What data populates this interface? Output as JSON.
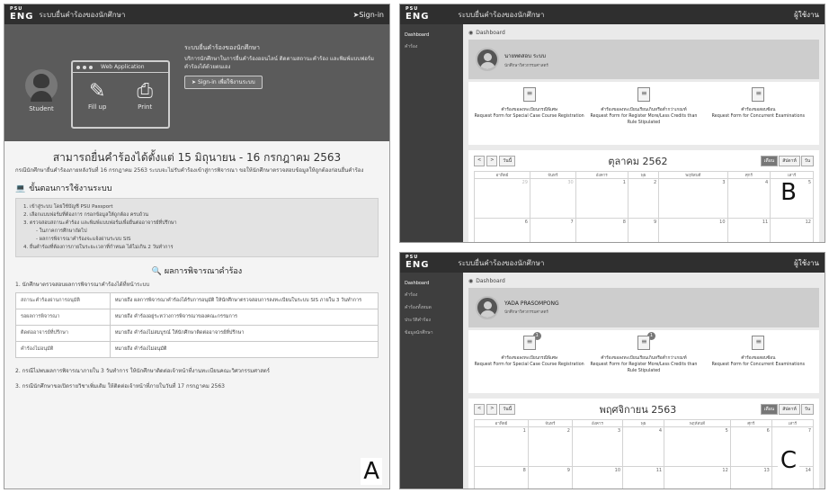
{
  "panelA": {
    "logo_top": "PSU",
    "logo_main": "ENG",
    "header_title": "ระบบยื่นคำร้องของนักศึกษา",
    "signin": "Sign-in",
    "hero": {
      "student_label": "Student",
      "web_app_label": "Web Application",
      "fillup_label": "Fill up",
      "print_label": "Print",
      "heading": "ระบบยื่นคำร้องของนักศึกษา",
      "desc": "บริการนักศึกษาในการยื่นคำร้องออนไลน์ ติดตามสถานะคำร้อง และพิมพ์แบบฟอร์มคำร้องได้ด้วยตนเอง",
      "button": "Sign-in เพื่อใช้งานระบบ"
    },
    "open_period": "สามารถยื่นคำร้องได้ตั้งแต่ 15 มิถุนายน - 16 กรกฎาคม 2563",
    "notice": "กรณีนักศึกษายื่นคำร้องภายหลังวันที่ 16 กรกฎาคม 2563 ระบบจะไม่รับคำร้องเข้าสู่การพิจารณา ขอให้นักศึกษาตรวจสอบข้อมูลให้ถูกต้องก่อนยื่นคำร้อง",
    "steps_title": "ขั้นตอนการใช้งานระบบ",
    "steps": [
      "1. เข้าสู่ระบบ โดยใช้บัญชี PSU Passport",
      "2. เลือกแบบฟอร์มที่ต้องการ กรอกข้อมูลให้ถูกต้อง ครบถ้วน",
      "3. ตรวจสอบสถานะคำร้อง และพิมพ์แบบฟอร์มเพื่อยื่นต่ออาจารย์ที่ปรึกษา",
      "- ในภาคการศึกษาถัดไป",
      "- ผลการพิจารณาคำร้องจะแจ้งผ่านระบบ SIS",
      "4. ยื่นคำร้องที่ต้องการภายในระยะเวลาที่กำหนด ได้ไม่เกิน 2 วันทำการ"
    ],
    "result_title": "ผลการพิจารณาคำร้อง",
    "result_intro": "1. นักศึกษาตรวจสอบผลการพิจารณาคำร้องได้ที่หน้าระบบ",
    "result_rows": [
      {
        "status": "สถานะคำร้องผ่านการอนุมัติ",
        "detail": "หมายถึง ผลการพิจารณาคำร้องได้รับการอนุมัติ ให้นักศึกษาตรวจสอบการลงทะเบียนในระบบ SIS ภายใน 3 วันทำการ"
      },
      {
        "status": "รอผลการพิจารณา",
        "detail": "หมายถึง คำร้องอยู่ระหว่างการพิจารณาของคณะกรรมการ"
      },
      {
        "status": "ติดต่ออาจารย์ที่ปรึกษา",
        "detail": "หมายถึง คำร้องไม่สมบูรณ์ ให้นักศึกษาติดต่ออาจารย์ที่ปรึกษา"
      },
      {
        "status": "คำร้องไม่อนุมัติ",
        "detail": "หมายถึง คำร้องไม่อนุมัติ"
      }
    ],
    "footer_2": "2. กรณีไม่พบผลการพิจารณาภายใน 3 วันทำการ ให้นักศึกษาติดต่อเจ้าหน้าที่งานทะเบียนคณะวิศวกรรมศาสตร์",
    "footer_3": "3. กรณีนักศึกษาขอเปิดรายวิชาเพิ่มเติม ให้ติดต่อเจ้าหน้าที่ภายในวันที่ 17 กรกฎาคม 2563",
    "letter": "A"
  },
  "panelB": {
    "logo_top": "PSU",
    "logo_main": "ENG",
    "header_title": "ระบบยื่นคำร้องของนักศึกษา",
    "user": "ผู้ใช้งาน",
    "menu": [
      "Dashboard",
      "คำร้อง"
    ],
    "crumb": "Dashboard",
    "profile_name": "นายทดสอบ ระบบ",
    "profile_sub": "นักศึกษาวิศวกรรมศาสตร์",
    "forms": [
      {
        "th": "คำร้องขอลงทะเบียนกรณีพิเศษ",
        "en": "Request Form for Special Case Course Registration"
      },
      {
        "th": "คำร้องขอลงทะเบียนเรียนเกินหรือต่ำกว่าเกณฑ์",
        "en": "Request Form for Register More/Less Credits than Rule Stipulated"
      },
      {
        "th": "คำร้องขอสอบซ้อน",
        "en": "Request Form for Concurrent Examinations"
      }
    ],
    "cal": {
      "prev": "<",
      "next": ">",
      "today": "วันนี้",
      "title": "ตุลาคม 2562",
      "views": [
        "เดือน",
        "สัปดาห์",
        "วัน"
      ],
      "days": [
        "อาทิตย์",
        "จันทร์",
        "อังคาร",
        "พุธ",
        "พฤหัสบดี",
        "ศุกร์",
        "เสาร์"
      ],
      "row1": [
        "29",
        "30",
        "1",
        "2",
        "3",
        "4",
        "5"
      ],
      "row2": [
        "6",
        "7",
        "8",
        "9",
        "10",
        "11",
        "12"
      ]
    },
    "letter": "B"
  },
  "panelC": {
    "logo_top": "PSU",
    "logo_main": "ENG",
    "header_title": "ระบบยื่นคำร้องของนักศึกษา",
    "user": "ผู้ใช้งาน",
    "menu": [
      "Dashboard",
      "คำร้อง",
      "คำร้องทั้งหมด",
      "ประวัติคำร้อง",
      "ข้อมูลนักศึกษา"
    ],
    "crumb": "Dashboard",
    "profile_name": "YADA PRASOMPONG",
    "profile_sub": "นักศึกษาวิศวกรรมศาสตร์",
    "forms": [
      {
        "th": "คำร้องขอลงทะเบียนกรณีพิเศษ",
        "en": "Request Form for Special Case Course Registration",
        "badge": "1"
      },
      {
        "th": "คำร้องขอลงทะเบียนเรียนเกินหรือต่ำกว่าเกณฑ์",
        "en": "Request Form for Register More/Less Credits than Rule Stipulated",
        "badge": "1"
      },
      {
        "th": "คำร้องขอสอบซ้อน",
        "en": "Request Form for Concurrent Examinations",
        "badge": ""
      }
    ],
    "cal": {
      "prev": "<",
      "next": ">",
      "today": "วันนี้",
      "title": "พฤศจิกายน 2563",
      "views": [
        "เดือน",
        "สัปดาห์",
        "วัน"
      ],
      "days": [
        "อาทิตย์",
        "จันทร์",
        "อังคาร",
        "พุธ",
        "พฤหัสบดี",
        "ศุกร์",
        "เสาร์"
      ],
      "row1": [
        "1",
        "2",
        "3",
        "4",
        "5",
        "6",
        "7"
      ],
      "row2": [
        "8",
        "9",
        "10",
        "11",
        "12",
        "13",
        "14"
      ]
    },
    "letter": "C"
  }
}
